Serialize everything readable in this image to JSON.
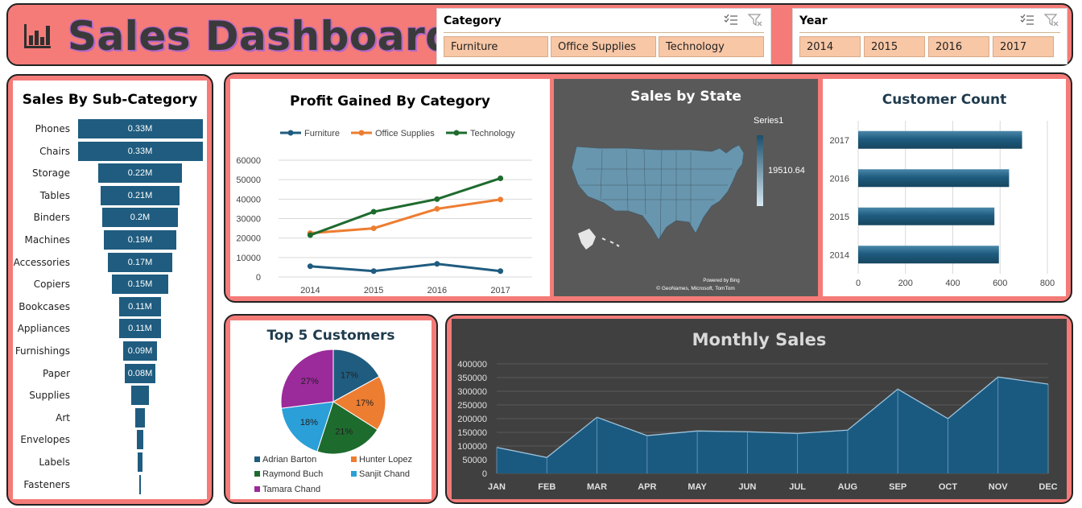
{
  "header": {
    "title": "Sales Dashboard"
  },
  "slicers": {
    "category": {
      "title": "Category",
      "items": [
        "Furniture",
        "Office Supplies",
        "Technology"
      ]
    },
    "year": {
      "title": "Year",
      "items": [
        "2014",
        "2015",
        "2016",
        "2017"
      ]
    }
  },
  "colors": {
    "panel": "#f47b78",
    "bar": "#1f5c7f",
    "furniture": "#1f5c7f",
    "office_supplies": "#ed7d31",
    "technology": "#1e6b2e"
  },
  "chart_data": [
    {
      "id": "subcategory",
      "type": "bar",
      "title": "Sales By Sub-Category",
      "categories": [
        "Phones",
        "Chairs",
        "Storage",
        "Tables",
        "Binders",
        "Machines",
        "Accessories",
        "Copiers",
        "Bookcases",
        "Appliances",
        "Furnishings",
        "Paper",
        "Supplies",
        "Art",
        "Envelopes",
        "Labels",
        "Fasteners"
      ],
      "values": [
        0.33,
        0.33,
        0.22,
        0.21,
        0.2,
        0.19,
        0.17,
        0.15,
        0.11,
        0.11,
        0.09,
        0.08,
        0.047,
        0.027,
        0.016,
        0.012,
        0.003
      ],
      "labels": [
        "0.33M",
        "0.33M",
        "0.22M",
        "0.21M",
        "0.2M",
        "0.19M",
        "0.17M",
        "0.15M",
        "0.11M",
        "0.11M",
        "0.09M",
        "0.08M",
        "",
        "",
        "",
        "",
        ""
      ]
    },
    {
      "id": "profit",
      "type": "line",
      "title": "Profit Gained By Category",
      "x": [
        "2014",
        "2015",
        "2016",
        "2017"
      ],
      "y_ticks": [
        "0",
        "10000",
        "20000",
        "30000",
        "40000",
        "50000",
        "60000"
      ],
      "ylim": [
        0,
        60000
      ],
      "series": [
        {
          "name": "Furniture",
          "values": [
            5500,
            3000,
            6700,
            3000
          ]
        },
        {
          "name": "Office Supplies",
          "values": [
            22500,
            25000,
            35000,
            39800
          ]
        },
        {
          "name": "Technology",
          "values": [
            21500,
            33500,
            40000,
            50700
          ]
        }
      ]
    },
    {
      "id": "state",
      "type": "heatmap",
      "title": "Sales by State",
      "legend_title": "Series1",
      "legend_value": "19510.64",
      "credit_line1": "Powered by Bing",
      "credit_line2": "© GeoNames, Microsoft, TomTom"
    },
    {
      "id": "customers",
      "type": "bar",
      "title": "Customer Count",
      "categories": [
        "2017",
        "2016",
        "2015",
        "2014"
      ],
      "values": [
        693,
        638,
        576,
        595
      ],
      "x_ticks": [
        "0",
        "200",
        "400",
        "600",
        "800"
      ],
      "xlim": [
        0,
        800
      ]
    },
    {
      "id": "top5",
      "type": "pie",
      "title": "Top  5 Customers",
      "labels": [
        "Adrian Barton",
        "Hunter Lopez",
        "Raymond Buch",
        "Sanjit Chand",
        "Tamara Chand"
      ],
      "values": [
        17,
        17,
        21,
        18,
        27
      ],
      "value_labels": [
        "17%",
        "17%",
        "21%",
        "18%",
        "27%"
      ]
    },
    {
      "id": "monthly",
      "type": "area",
      "title": "Monthly Sales",
      "x": [
        "JAN",
        "FEB",
        "MAR",
        "APR",
        "MAY",
        "JUN",
        "JUL",
        "AUG",
        "SEP",
        "OCT",
        "NOV",
        "DEC"
      ],
      "values": [
        95000,
        58000,
        205000,
        138000,
        155000,
        152000,
        146000,
        158000,
        308000,
        200000,
        352000,
        326000
      ],
      "y_ticks": [
        "0",
        "50000",
        "100000",
        "150000",
        "200000",
        "250000",
        "300000",
        "350000",
        "400000"
      ],
      "ylim": [
        0,
        400000
      ]
    }
  ]
}
